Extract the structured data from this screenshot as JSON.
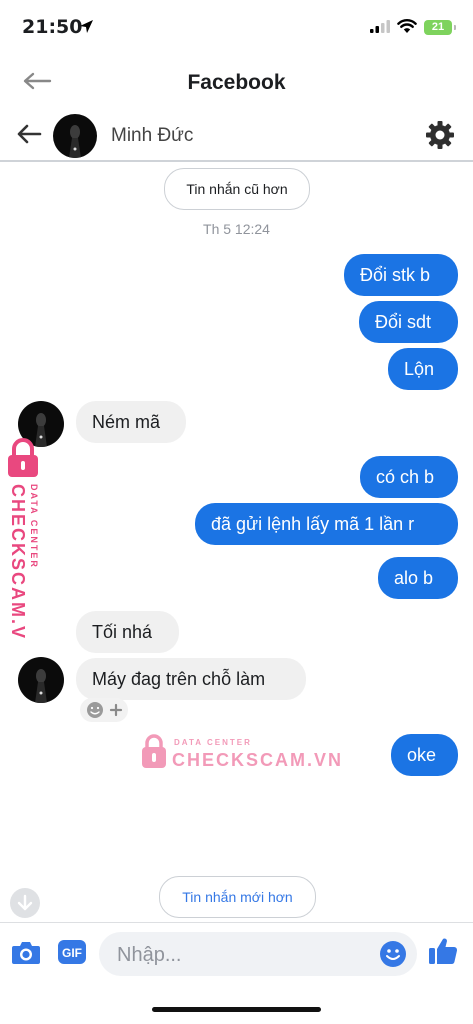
{
  "status_bar": {
    "time": "21:50",
    "battery": "21"
  },
  "browser": {
    "title": "Facebook"
  },
  "chat_header": {
    "contact_name": "Minh Đức"
  },
  "older_messages_label": "Tin nhắn cũ hơn",
  "newer_messages_label": "Tin nhắn mới hơn",
  "timestamp": "Th 5 12:24",
  "messages": [
    {
      "from": "me",
      "text": "Đổi stk b"
    },
    {
      "from": "me",
      "text": "Đổi sdt"
    },
    {
      "from": "me",
      "text": "Lộn"
    },
    {
      "from": "them",
      "text": "Ném mã"
    },
    {
      "from": "me",
      "text": "có ch b"
    },
    {
      "from": "me",
      "text": "đã gửi lệnh lấy mã 1 lần r"
    },
    {
      "from": "me",
      "text": "alo b"
    },
    {
      "from": "them",
      "text": "Tối nhá"
    },
    {
      "from": "them",
      "text": "Máy đag trên chỗ làm"
    },
    {
      "from": "me",
      "text": "oke"
    }
  ],
  "watermark": {
    "brand": "CHECKSCAM.VN",
    "tagline": "DATA CENTER"
  },
  "composer": {
    "placeholder": "Nhập..."
  },
  "bottom_icons": [
    "camera-icon",
    "gif-icon",
    "emoji-icon",
    "thumbs-up-icon"
  ],
  "colors": {
    "outgoing_bubble": "#1b74e4",
    "incoming_bubble": "#f0f0f0",
    "accent": "#3578e5",
    "watermark": "#e9487f"
  }
}
